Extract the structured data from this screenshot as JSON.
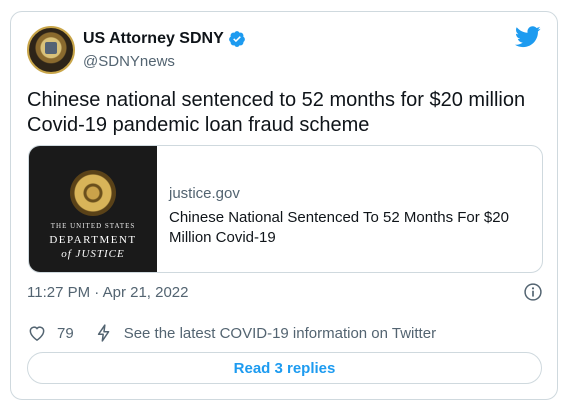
{
  "author": {
    "name": "US Attorney SDNY",
    "handle": "@SDNYnews"
  },
  "tweet": {
    "text": "Chinese national sentenced to 52 months for $20 million Covid-19 pandemic loan fraud scheme",
    "timestamp": "11:27 PM · Apr 21, 2022"
  },
  "card": {
    "image_text": {
      "line1": "THE UNITED STATES",
      "line2": "DEPARTMENT",
      "line3": "of JUSTICE"
    },
    "domain": "justice.gov",
    "title": "Chinese National Sentenced To 52 Months For $20 Million Covid-19"
  },
  "actions": {
    "like_count": "79",
    "covid_info": "See the latest COVID-19 information on Twitter"
  },
  "replies_button": "Read 3 replies",
  "colors": {
    "accent": "#1d9bf0",
    "text": "#0f1419",
    "secondary": "#536471",
    "border": "#cfd9de"
  },
  "icons": [
    "verified-badge-icon",
    "twitter-bird-icon",
    "info-icon",
    "heart-icon",
    "lightning-icon"
  ]
}
